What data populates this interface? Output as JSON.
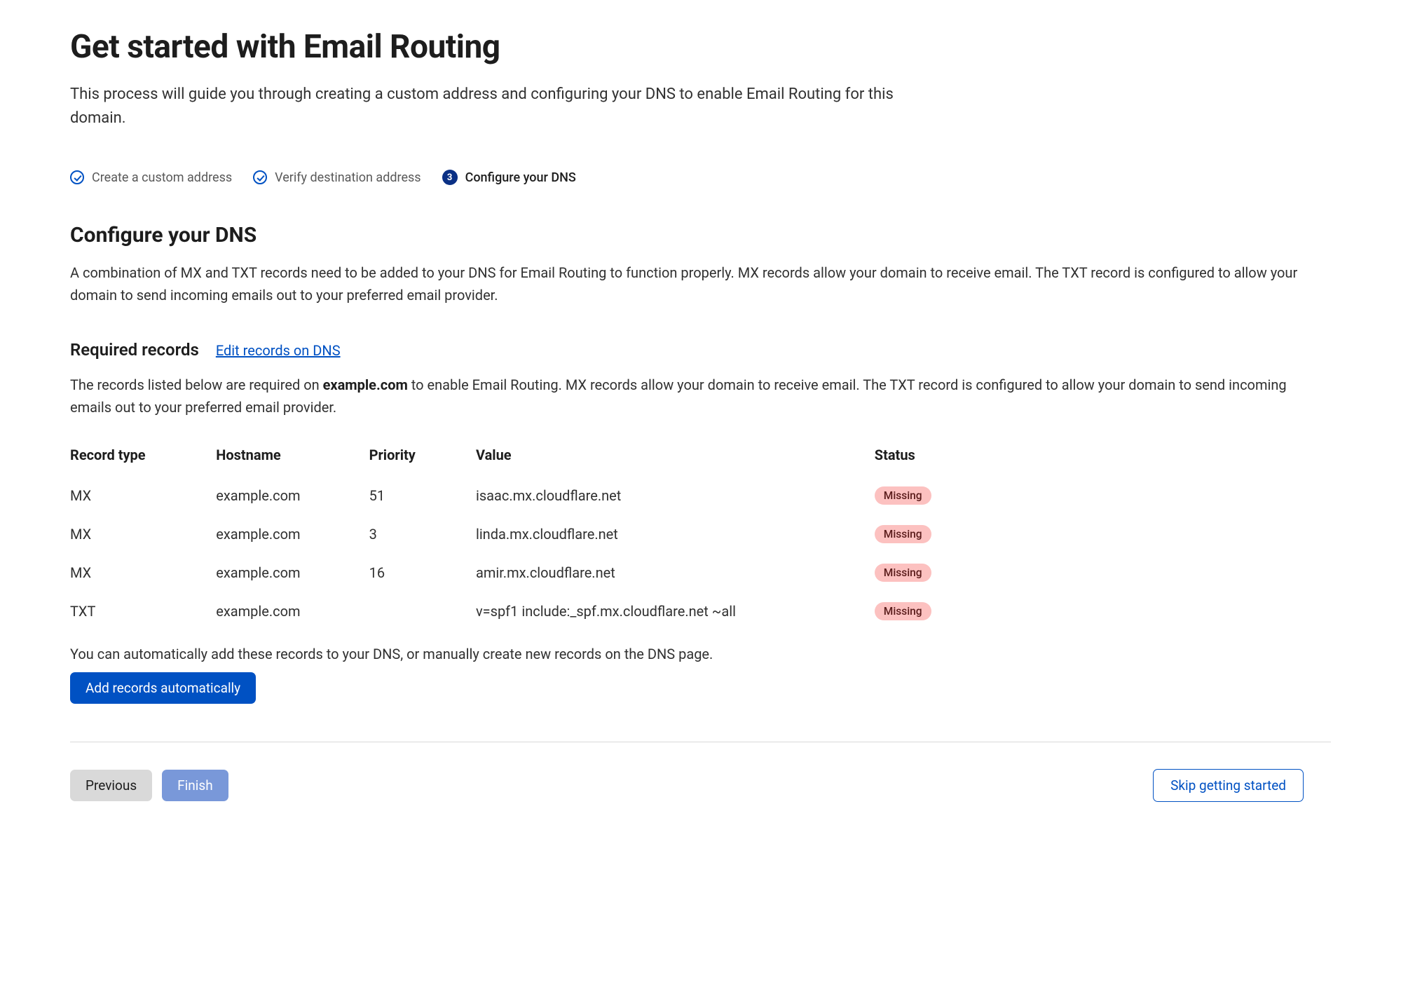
{
  "title": "Get started with Email Routing",
  "intro": "This process will guide you through creating a custom address and configuring your DNS to enable Email Routing for this domain.",
  "steps": [
    {
      "label": "Create a custom address",
      "state": "done"
    },
    {
      "label": "Verify destination address",
      "state": "done"
    },
    {
      "label": "Configure your DNS",
      "state": "current",
      "badge": "3"
    }
  ],
  "section": {
    "heading": "Configure your DNS",
    "desc": "A combination of MX and TXT records need to be added to your DNS for Email Routing to function properly. MX records allow your domain to receive email. The TXT record is configured to allow your domain to send incoming emails out to your preferred email provider."
  },
  "required": {
    "heading": "Required records",
    "edit_link": "Edit records on DNS",
    "desc_pre": "The records listed below are required on ",
    "domain": "example.com",
    "desc_post": " to enable Email Routing. MX records allow your domain to receive email. The TXT record is configured to allow your domain to send incoming emails out to your preferred email provider."
  },
  "table": {
    "headers": {
      "type": "Record type",
      "hostname": "Hostname",
      "priority": "Priority",
      "value": "Value",
      "status": "Status"
    },
    "rows": [
      {
        "type": "MX",
        "hostname": "example.com",
        "priority": "51",
        "value": "isaac.mx.cloudflare.net",
        "status": "Missing"
      },
      {
        "type": "MX",
        "hostname": "example.com",
        "priority": "3",
        "value": "linda.mx.cloudflare.net",
        "status": "Missing"
      },
      {
        "type": "MX",
        "hostname": "example.com",
        "priority": "16",
        "value": "amir.mx.cloudflare.net",
        "status": "Missing"
      },
      {
        "type": "TXT",
        "hostname": "example.com",
        "priority": "",
        "value": "v=spf1 include:_spf.mx.cloudflare.net ~all",
        "status": "Missing"
      }
    ]
  },
  "after_table": "You can automatically add these records to your DNS, or manually create new records on the DNS page.",
  "buttons": {
    "add_auto": "Add records automatically",
    "previous": "Previous",
    "finish": "Finish",
    "skip": "Skip getting started"
  }
}
